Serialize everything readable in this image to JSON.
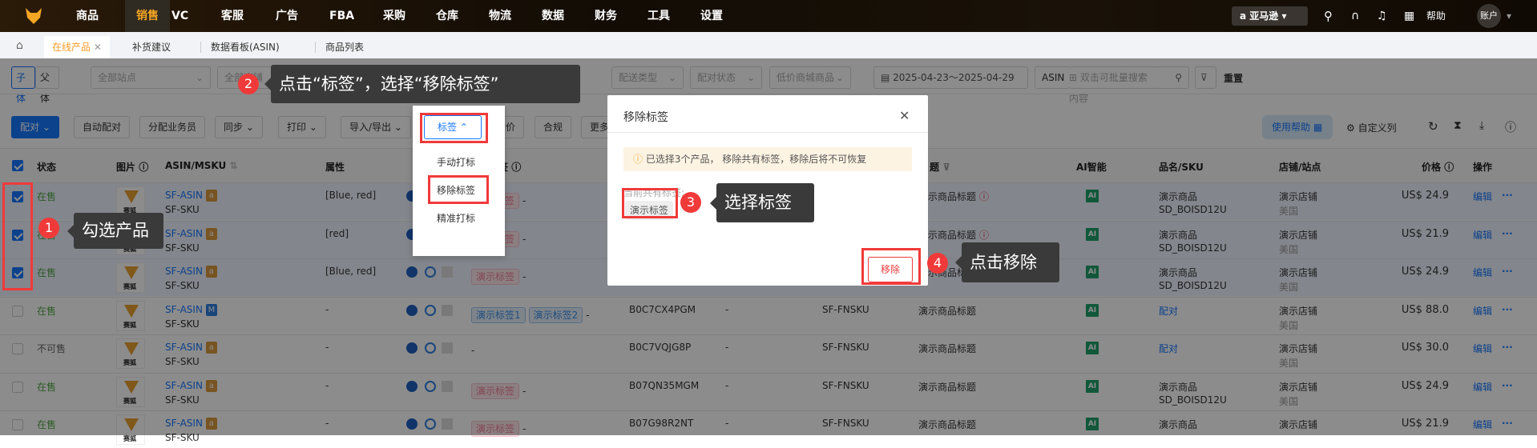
{
  "nav": {
    "items": [
      "商品",
      "销售",
      "VC",
      "客服",
      "广告",
      "FBA",
      "采购",
      "仓库",
      "物流",
      "数据",
      "财务",
      "工具",
      "设置"
    ],
    "active": "销售",
    "marketplace": "亚马逊",
    "help": "帮助",
    "account": "账户"
  },
  "tabs": [
    {
      "label": "在线产品",
      "active": true
    },
    {
      "label": "补货建议"
    },
    {
      "label": "数据看板(ASIN)"
    },
    {
      "label": "商品列表"
    }
  ],
  "filters": {
    "child": "子体",
    "parent": "父体",
    "site": "全部站点",
    "shop": "全部店铺",
    "delivery": "配送类型",
    "pair_status": "配对状态",
    "low_price": "低价商城商品",
    "date_range": "2025-04-23～2025-04-29",
    "search_field": "ASIN",
    "search_placeholder": "双击可批量搜索内容",
    "reset": "重置"
  },
  "toolbar": {
    "pair": "配对",
    "auto_pair": "自动配对",
    "assign": "分配业务员",
    "sync": "同步",
    "print": "打印",
    "import_export": "导入/导出",
    "tag": "标签",
    "reprice": "调价",
    "compliance": "合规",
    "more": "更多",
    "help": "使用帮助",
    "custom_cols": "自定义列"
  },
  "tag_menu": {
    "items": [
      "手动打标",
      "移除标签",
      "精准打标"
    ]
  },
  "columns": {
    "status": "状态",
    "image": "图片",
    "asin_msku": "ASIN/MSKU",
    "attr": "属性",
    "tags": "标签",
    "title": "题",
    "ai": "AI智能",
    "name_sku": "品名/SKU",
    "shop_site": "店铺/站点",
    "price": "价格",
    "ops": "操作"
  },
  "rows": [
    {
      "checked": true,
      "status": "在售",
      "status_color": "#52a845",
      "asin": "SF-ASIN",
      "badge": "a",
      "msku": "SF-SKU",
      "attr": "[Blue, red]",
      "tags": [
        {
          "t": "演示标签",
          "c": "pink"
        }
      ],
      "asin2": "",
      "dash": "",
      "fnsku": "",
      "title": "演示商品标题",
      "warn": true,
      "name": "演示商品",
      "sku": "SD_BOISD12U",
      "shop": "演示店铺",
      "site": "美国",
      "price": "US$ 24.9",
      "edit": "编辑"
    },
    {
      "checked": true,
      "status": "在售",
      "status_color": "#52a845",
      "asin": "SF-ASIN",
      "badge": "a",
      "msku": "SF-SKU",
      "attr": "[red]",
      "tags": [
        {
          "t": "演示标签",
          "c": "pink"
        }
      ],
      "asin2": "",
      "dash": "",
      "fnsku": "",
      "title": "演示商品标题",
      "warn": true,
      "name": "演示商品",
      "sku": "SD_BOISD12U",
      "shop": "演示店铺",
      "site": "美国",
      "price": "US$ 21.9",
      "edit": "编辑"
    },
    {
      "checked": true,
      "status": "在售",
      "status_color": "#52a845",
      "asin": "SF-ASIN",
      "badge": "a",
      "msku": "SF-SKU",
      "attr": "[Blue, red]",
      "tags": [
        {
          "t": "演示标签",
          "c": "pink"
        }
      ],
      "asin2": "",
      "dash": "",
      "fnsku": "",
      "title": "演示商品标题",
      "warn": true,
      "name": "演示商品",
      "sku": "SD_BOISD12U",
      "shop": "演示店铺",
      "site": "美国",
      "price": "US$ 24.9",
      "edit": "编辑"
    },
    {
      "checked": false,
      "status": "在售",
      "status_color": "#52a845",
      "asin": "SF-ASIN",
      "badge": "M",
      "msku": "SF-SKU",
      "attr": "-",
      "tags": [
        {
          "t": "演示标签1",
          "c": "blue"
        },
        {
          "t": "演示标签2",
          "c": "blue"
        }
      ],
      "asin2": "B0C7CX4PGM",
      "dash": "-",
      "fnsku": "SF-FNSKU",
      "title": "演示商品标题",
      "warn": false,
      "name": "配对",
      "name_link": true,
      "sku": "",
      "shop": "演示店铺",
      "site": "美国",
      "price": "US$ 88.0",
      "edit": "编辑"
    },
    {
      "checked": false,
      "status": "不可售",
      "status_color": "#666666",
      "asin": "SF-ASIN",
      "badge": "a",
      "msku": "SF-SKU",
      "attr": "-",
      "tags": [],
      "asin2": "B0C7VQJG8P",
      "dash": "-",
      "fnsku": "SF-FNSKU",
      "title": "演示商品标题",
      "warn": false,
      "name": "配对",
      "name_link": true,
      "sku": "",
      "shop": "演示店铺",
      "site": "美国",
      "price": "US$ 30.0",
      "edit": "编辑"
    },
    {
      "checked": false,
      "status": "在售",
      "status_color": "#52a845",
      "asin": "SF-ASIN",
      "badge": "a",
      "msku": "SF-SKU",
      "attr": "-",
      "tags": [
        {
          "t": "演示标签",
          "c": "pink"
        }
      ],
      "asin2": "B07QN35MGM",
      "dash": "-",
      "fnsku": "SF-FNSKU",
      "title": "演示商品标题",
      "warn": false,
      "name": "演示商品",
      "sku": "SD_BOISD12U",
      "shop": "演示店铺",
      "site": "美国",
      "price": "US$ 24.9",
      "edit": "编辑"
    },
    {
      "checked": false,
      "status": "在售",
      "status_color": "#52a845",
      "asin": "SF-ASIN",
      "badge": "a",
      "msku": "SF-SKU",
      "attr": "-",
      "tags": [
        {
          "t": "演示标签",
          "c": "pink"
        }
      ],
      "asin2": "B07G98R2NT",
      "dash": "-",
      "fnsku": "SF-FNSKU",
      "title": "演示商品标题",
      "warn": false,
      "name": "演示商品",
      "sku": "",
      "shop": "演示店铺",
      "site": "",
      "price": "US$ 21.9",
      "edit": "编辑"
    }
  ],
  "modal": {
    "title": "移除标签",
    "alert": "已选择3个产品， 移除共有标签，移除后将不可恢复",
    "label": "当前共有标签:",
    "tag": "演示标签",
    "remove": "移除"
  },
  "guide": {
    "step1": {
      "n": "1",
      "text": "勾选产品"
    },
    "step2": {
      "n": "2",
      "text": "点击“标签”，选择“移除标签”"
    },
    "step3": {
      "n": "3",
      "text": "选择标签"
    },
    "step4": {
      "n": "4",
      "text": "点击移除"
    }
  },
  "colors": {
    "brand": "#f5a623",
    "primary": "#1677ff",
    "danger": "#f03a3a"
  }
}
